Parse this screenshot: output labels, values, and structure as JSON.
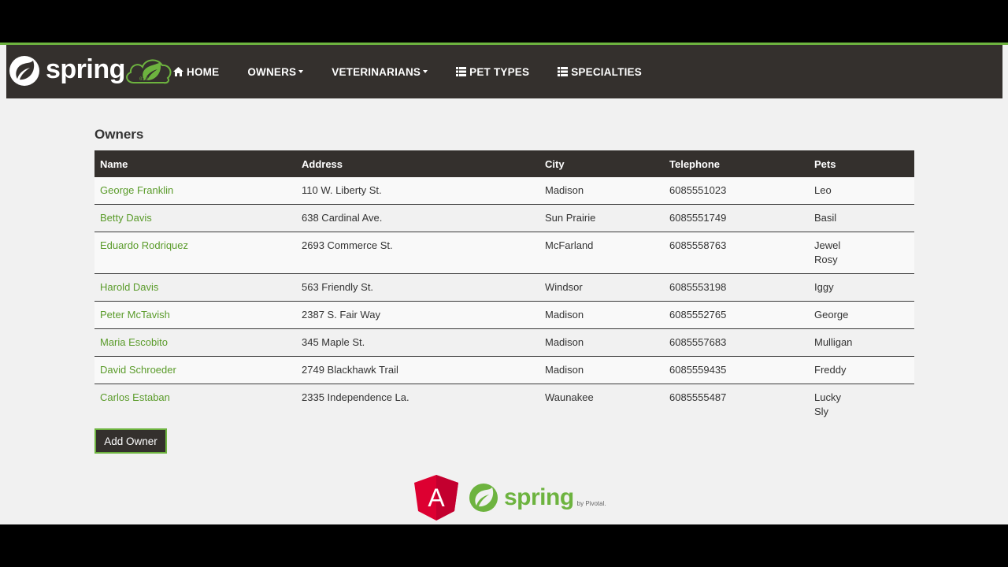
{
  "nav": {
    "brand": "spring",
    "items": [
      {
        "label": "Home",
        "icon": "home-icon"
      },
      {
        "label": "Owners",
        "dropdown": true
      },
      {
        "label": "Veterinarians",
        "dropdown": true
      },
      {
        "label": "Pet Types",
        "icon": "list-icon"
      },
      {
        "label": "Specialties",
        "icon": "list-icon"
      }
    ]
  },
  "page_title": "Owners",
  "table": {
    "headers": [
      "Name",
      "Address",
      "City",
      "Telephone",
      "Pets"
    ],
    "rows": [
      {
        "name": "George Franklin",
        "address": "110 W. Liberty St.",
        "city": "Madison",
        "telephone": "6085551023",
        "pets": [
          "Leo"
        ]
      },
      {
        "name": "Betty Davis",
        "address": "638 Cardinal Ave.",
        "city": "Sun Prairie",
        "telephone": "6085551749",
        "pets": [
          "Basil"
        ]
      },
      {
        "name": "Eduardo Rodriquez",
        "address": "2693 Commerce St.",
        "city": "McFarland",
        "telephone": "6085558763",
        "pets": [
          "Jewel",
          "Rosy"
        ]
      },
      {
        "name": "Harold Davis",
        "address": "563 Friendly St.",
        "city": "Windsor",
        "telephone": "6085553198",
        "pets": [
          "Iggy"
        ]
      },
      {
        "name": "Peter McTavish",
        "address": "2387 S. Fair Way",
        "city": "Madison",
        "telephone": "6085552765",
        "pets": [
          "George"
        ]
      },
      {
        "name": "Maria Escobito",
        "address": "345 Maple St.",
        "city": "Madison",
        "telephone": "6085557683",
        "pets": [
          "Mulligan"
        ]
      },
      {
        "name": "David Schroeder",
        "address": "2749 Blackhawk Trail",
        "city": "Madison",
        "telephone": "6085559435",
        "pets": [
          "Freddy"
        ]
      },
      {
        "name": "Carlos Estaban",
        "address": "2335 Independence La.",
        "city": "Waunakee",
        "telephone": "6085555487",
        "pets": [
          "Lucky",
          "Sly"
        ]
      }
    ]
  },
  "add_owner_label": "Add Owner",
  "footer": {
    "angular_letter": "A",
    "spring_word": "spring",
    "pivotal": "by Pivotal."
  },
  "colors": {
    "nav_bg": "#34302d",
    "accent": "#6db33f",
    "link": "#5a9b2a"
  }
}
